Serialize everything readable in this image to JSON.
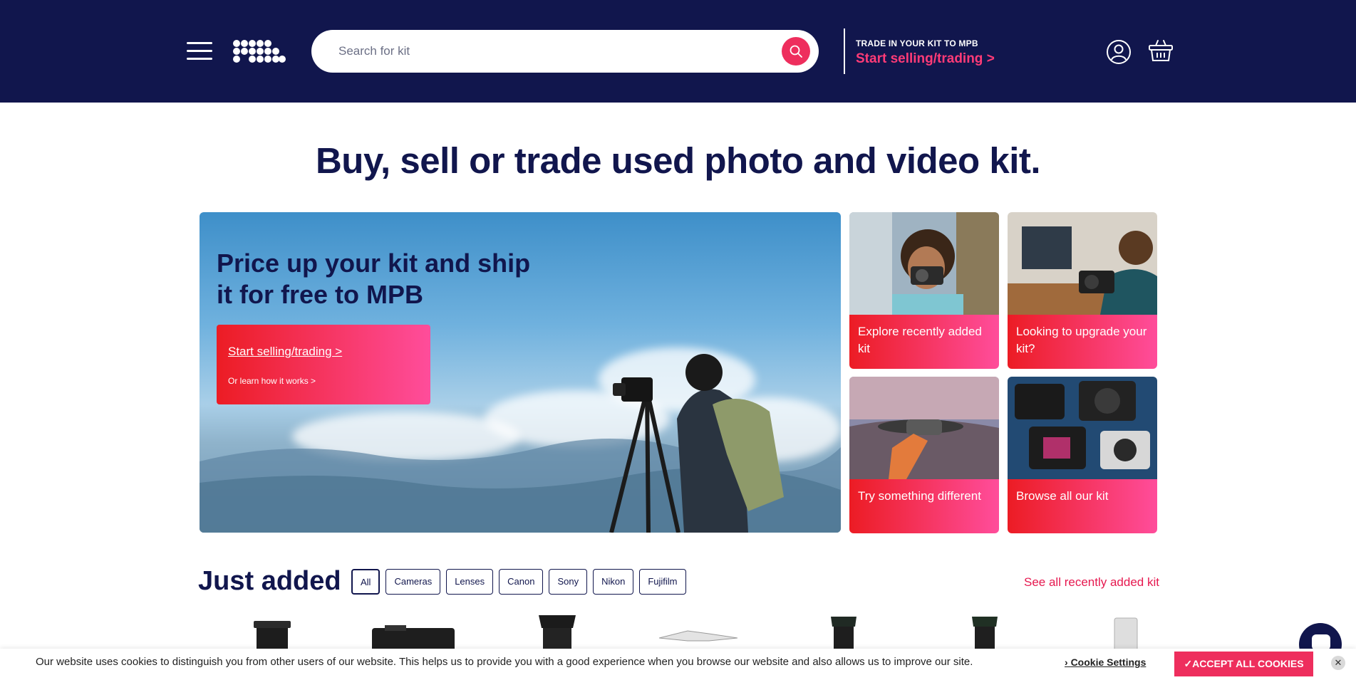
{
  "header": {
    "search_placeholder": "Search for kit",
    "trade_small": "TRADE IN YOUR KIT TO MPB",
    "trade_link": "Start selling/trading >",
    "icons": [
      "menu-icon",
      "mpb-logo",
      "search-icon",
      "account-icon",
      "basket-icon"
    ]
  },
  "hero": {
    "title": "Buy, sell or trade used photo and video kit.",
    "banner_heading": "Price up your kit and ship it for free to MPB",
    "cta_primary": "Start selling/trading >",
    "cta_secondary": "Or learn how it works >"
  },
  "tiles": [
    {
      "label": "Explore recently added kit"
    },
    {
      "label": "Looking to upgrade your kit?"
    },
    {
      "label": "Try something different"
    },
    {
      "label": "Browse all our kit"
    }
  ],
  "just_added": {
    "heading": "Just added",
    "filters": [
      "All",
      "Cameras",
      "Lenses",
      "Canon",
      "Sony",
      "Nikon",
      "Fujifilm"
    ],
    "active_filter": "All",
    "see_all": "See all recently added kit"
  },
  "cookie_banner": {
    "message": "Our website uses cookies to distinguish you from other users of our website. This helps us to provide you with a good experience when you browse our website and also allows us to improve our site.",
    "settings": "Cookie Settings",
    "accept": "✓ACCEPT ALL COOKIES",
    "close": "✕"
  },
  "colors": {
    "navy": "#11164d",
    "accent_pink": "#ee2e5d",
    "gradient_start": "#ec1c24",
    "gradient_end": "#ff4d9b"
  }
}
